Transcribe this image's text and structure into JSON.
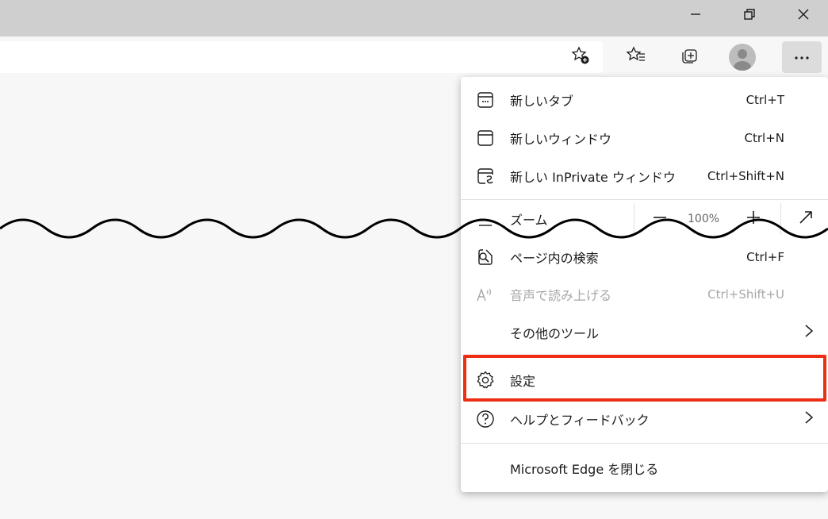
{
  "window_controls": {
    "minimize": "minimize-icon",
    "restore": "restore-icon",
    "close": "close-icon"
  },
  "toolbar_icons": [
    "add-favorite-icon",
    "favorites-icon",
    "collections-icon",
    "profile-avatar",
    "more-icon"
  ],
  "menu": {
    "new_tab": {
      "label": "新しいタブ",
      "shortcut": "Ctrl+T"
    },
    "new_window": {
      "label": "新しいウィンドウ",
      "shortcut": "Ctrl+N"
    },
    "new_inprivate": {
      "label": "新しい InPrivate ウィンドウ",
      "shortcut": "Ctrl+Shift+N"
    },
    "zoom": {
      "label": "ズーム",
      "value": "100%"
    },
    "find": {
      "label": "ページ内の検索",
      "shortcut": "Ctrl+F"
    },
    "read_aloud": {
      "label": "音声で読み上げる",
      "shortcut": "Ctrl+Shift+U"
    },
    "more_tools": {
      "label": "その他のツール"
    },
    "settings": {
      "label": "設定"
    },
    "help": {
      "label": "ヘルプとフィードバック"
    },
    "close_edge": {
      "label": "Microsoft Edge を閉じる"
    }
  },
  "colors": {
    "highlight": "#ee2e14",
    "titlebar": "#cfcfcf"
  }
}
